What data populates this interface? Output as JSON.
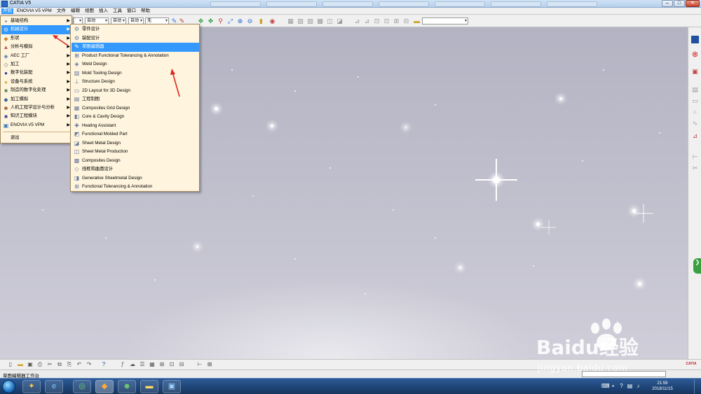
{
  "window": {
    "title": "CATIA V5",
    "buttons": [
      "–",
      "□",
      "✕"
    ]
  },
  "menubar": {
    "items": [
      {
        "label": "开始",
        "active": true
      },
      {
        "label": "ENOVIA V5 VPM",
        "active": false
      },
      {
        "label": "文件",
        "active": false
      },
      {
        "label": "编辑",
        "active": false
      },
      {
        "label": "视图",
        "active": false
      },
      {
        "label": "插入",
        "active": false
      },
      {
        "label": "工具",
        "active": false
      },
      {
        "label": "窗口",
        "active": false
      },
      {
        "label": "帮助",
        "active": false
      }
    ]
  },
  "toolbar_top": {
    "dropdowns": [
      "",
      "自动",
      "自动",
      "自动",
      "无"
    ]
  },
  "start_menu": {
    "items": [
      {
        "label": "基础结构",
        "icon": "cube-icon",
        "glyph": "▪",
        "color": "#2a55b0",
        "highlight": false
      },
      {
        "label": "机械设计",
        "icon": "gear-icon",
        "glyph": "⚙",
        "color": "#3a6fc0",
        "highlight": true
      },
      {
        "label": "形状",
        "icon": "shape-icon",
        "glyph": "◆",
        "color": "#d08a2a",
        "highlight": false
      },
      {
        "label": "分析与模拟",
        "icon": "analysis-icon",
        "glyph": "▲",
        "color": "#c04a4a",
        "highlight": false
      },
      {
        "label": "AEC 工厂",
        "icon": "factory-icon",
        "glyph": "◈",
        "color": "#4a7ab0",
        "highlight": false
      },
      {
        "label": "加工",
        "icon": "machining-icon",
        "glyph": "◇",
        "color": "#6a6a6a",
        "highlight": false
      },
      {
        "label": "数字化装配",
        "icon": "assembly-icon",
        "glyph": "●",
        "color": "#2a3a90",
        "highlight": false
      },
      {
        "label": "设备与系统",
        "icon": "equipment-icon",
        "glyph": "●",
        "color": "#e0b030",
        "highlight": false
      },
      {
        "label": "制造的数字化处理",
        "icon": "digital-process-icon",
        "glyph": "■",
        "color": "#5a8a5a",
        "highlight": false
      },
      {
        "label": "加工模拟",
        "icon": "machining-sim-icon",
        "glyph": "◆",
        "color": "#3a6a9a",
        "highlight": false
      },
      {
        "label": "人机工程学设计与分析",
        "icon": "ergonomics-icon",
        "glyph": "☻",
        "color": "#a06030",
        "highlight": false
      },
      {
        "label": "知识工程模块",
        "icon": "knowledge-icon",
        "glyph": "■",
        "color": "#4a4a9a",
        "highlight": false
      },
      {
        "label": "ENOVIA V5 VPM",
        "icon": "enovia-icon",
        "glyph": "▣",
        "color": "#3a7ac0",
        "highlight": false
      },
      {
        "label": "退出",
        "icon": "",
        "glyph": "",
        "color": "#000000",
        "highlight": false
      }
    ]
  },
  "submenu": {
    "items": [
      {
        "label": "零件设计",
        "icon": "part-design-icon",
        "highlight": false
      },
      {
        "label": "装配设计",
        "icon": "assembly-design-icon",
        "highlight": false
      },
      {
        "label": "草图编辑器",
        "icon": "sketcher-icon",
        "highlight": true
      },
      {
        "label": "Product Functional Tolerancing & Annotation",
        "icon": "tolerancing-icon",
        "highlight": false
      },
      {
        "label": "Weld Design",
        "icon": "weld-icon",
        "highlight": false
      },
      {
        "label": "Mold Tooling Design",
        "icon": "mold-icon",
        "highlight": false
      },
      {
        "label": "Structure Design",
        "icon": "structure-icon",
        "highlight": false
      },
      {
        "label": "2D Layout for 3D Design",
        "icon": "layout-2d-icon",
        "highlight": false
      },
      {
        "label": "工程制图",
        "icon": "drafting-icon",
        "highlight": false
      },
      {
        "label": "Composites Grid Design",
        "icon": "composites-grid-icon",
        "highlight": false
      },
      {
        "label": "Core & Cavity Design",
        "icon": "core-cavity-icon",
        "highlight": false
      },
      {
        "label": "Healing Assistant",
        "icon": "healing-icon",
        "highlight": false
      },
      {
        "label": "Functional Molded Part",
        "icon": "molded-part-icon",
        "highlight": false
      },
      {
        "label": "Sheet Metal Design",
        "icon": "sheet-metal-icon",
        "highlight": false
      },
      {
        "label": "Sheet Metal Production",
        "icon": "sheet-metal-production-icon",
        "highlight": false
      },
      {
        "label": "Composites Design",
        "icon": "composites-icon",
        "highlight": false
      },
      {
        "label": "线框和曲面设计",
        "icon": "wireframe-icon",
        "highlight": false
      },
      {
        "label": "Generative Sheetmetal Design",
        "icon": "generative-sheetmetal-icon",
        "highlight": false
      },
      {
        "label": "Functional Tolerancing & Annotation",
        "icon": "functional-tolerancing-icon",
        "highlight": false
      }
    ]
  },
  "statusbar": {
    "text": "草图编辑器工作台"
  },
  "taskbar": {
    "clock_time": "21:59",
    "clock_date": "2018/11/15"
  },
  "watermark": {
    "brand": "Baidu经验",
    "url": "jingyan.baidu.com"
  },
  "logo": {
    "text": "CATIA"
  },
  "colors": {
    "highlight": "#3399ff",
    "menu_bg": "#fff4dd",
    "annotation": "#e0261f"
  }
}
